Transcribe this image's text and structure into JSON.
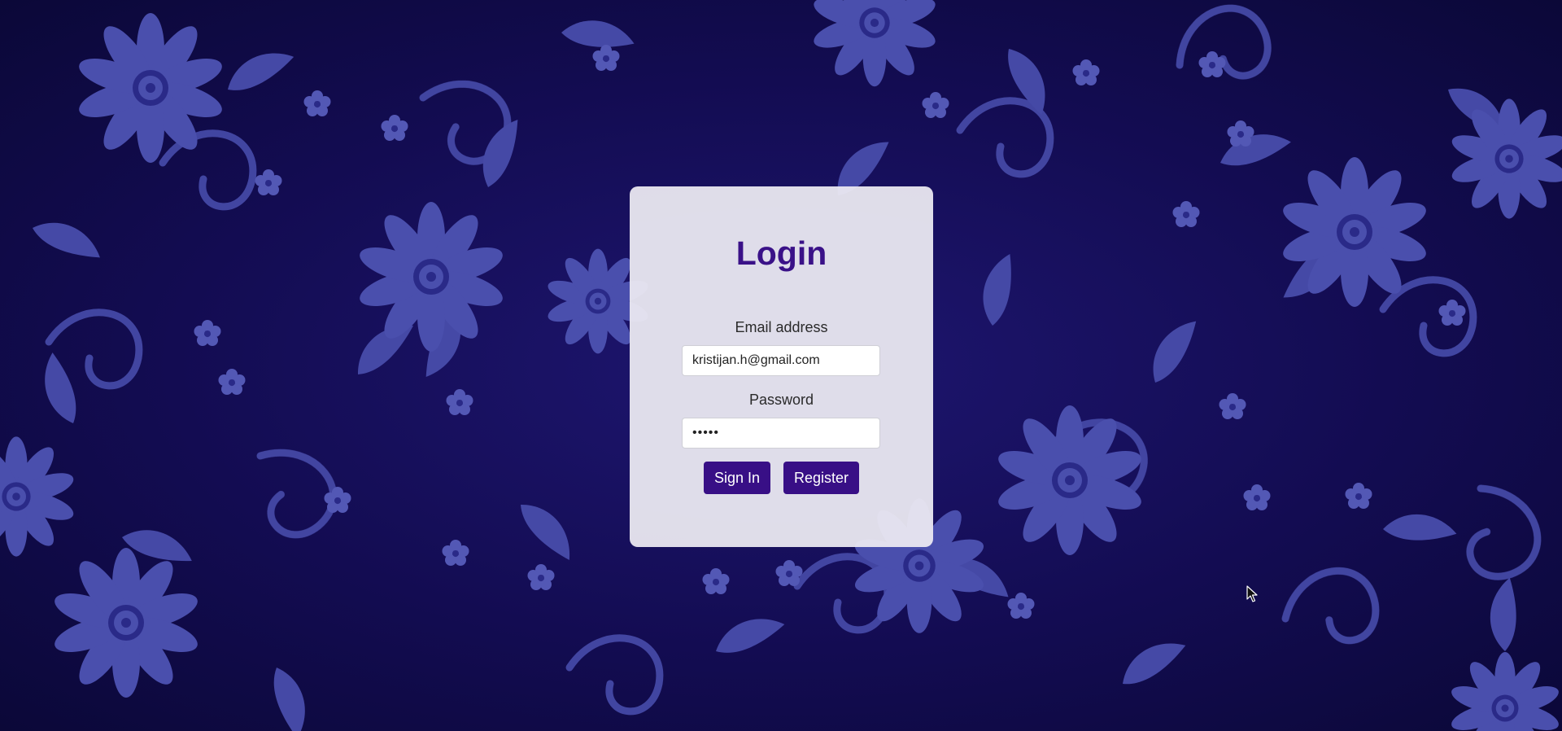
{
  "login": {
    "title": "Login",
    "email_label": "Email address",
    "email_value": "kristijan.h@gmail.com",
    "password_label": "Password",
    "password_value": "•••••",
    "sign_in_label": "Sign In",
    "register_label": "Register"
  },
  "colors": {
    "background_base": "#130c52",
    "pattern": "#4a4fad",
    "accent": "#380f86",
    "title": "#3a1188",
    "card": "#ecebf2"
  },
  "icons": {
    "cursor": "mouse-pointer-icon"
  }
}
